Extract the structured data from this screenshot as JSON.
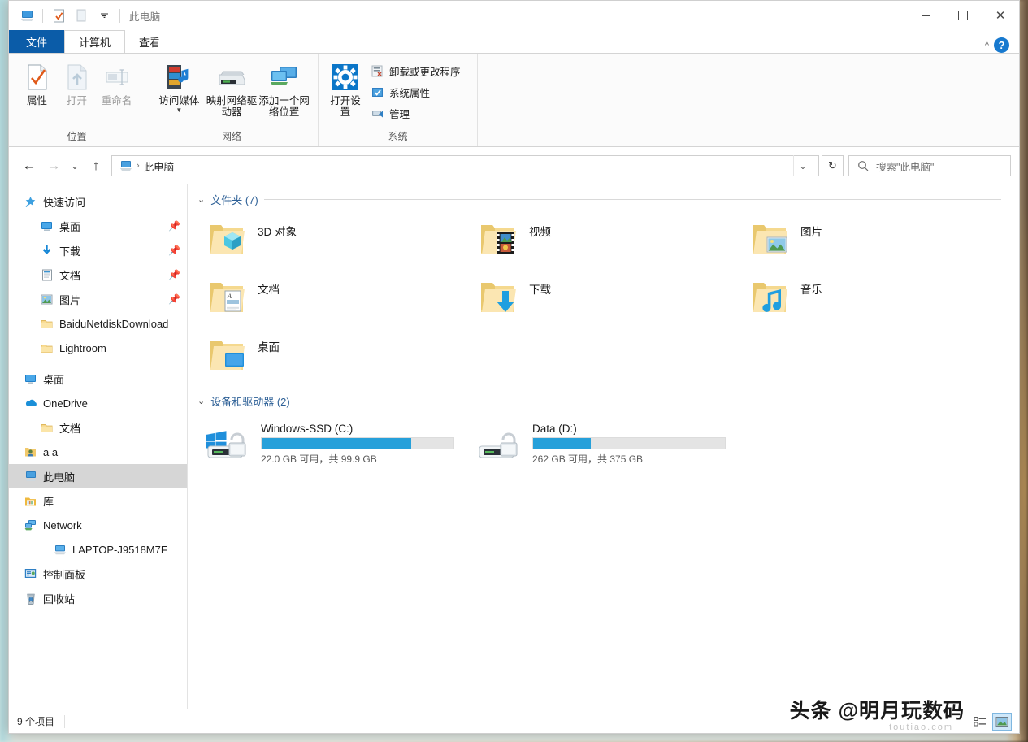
{
  "window": {
    "title": "此电脑",
    "quick_access_icons": [
      "this-pc-icon",
      "properties-check-icon",
      "open-folder-icon",
      "customize-dropdown-icon"
    ],
    "controls": {
      "minimize": "最小化",
      "maximize": "最大化",
      "close": "关闭"
    }
  },
  "tabs": [
    {
      "label": "文件",
      "type": "file"
    },
    {
      "label": "计算机",
      "type": "active"
    },
    {
      "label": "查看",
      "type": "normal"
    }
  ],
  "ribbon": {
    "collapse_label": "折叠功能区",
    "help_label": "?",
    "groups": [
      {
        "title": "位置",
        "big_buttons": [
          {
            "label": "属性",
            "icon": "properties-icon",
            "disabled": false
          },
          {
            "label": "打开",
            "icon": "open-icon",
            "disabled": true
          },
          {
            "label": "重命名",
            "icon": "rename-icon",
            "disabled": true
          }
        ],
        "small_items": []
      },
      {
        "title": "网络",
        "big_buttons": [
          {
            "label": "访问媒体",
            "icon": "access-media-icon",
            "disabled": false,
            "caret": true
          },
          {
            "label": "映射网络驱动器",
            "icon": "map-network-drive-icon",
            "disabled": false,
            "caret": true
          },
          {
            "label": "添加一个网络位置",
            "icon": "add-network-location-icon",
            "disabled": false,
            "caret": false
          }
        ],
        "small_items": []
      },
      {
        "title": "系统",
        "big_buttons": [
          {
            "label": "打开设置",
            "icon": "settings-gear-icon",
            "disabled": false
          }
        ],
        "small_items": [
          {
            "label": "卸载或更改程序",
            "icon": "uninstall-program-icon"
          },
          {
            "label": "系统属性",
            "icon": "system-properties-icon"
          },
          {
            "label": "管理",
            "icon": "manage-icon"
          }
        ]
      }
    ]
  },
  "addressbar": {
    "back": "后退",
    "forward": "前进",
    "recent": "最近位置",
    "up": "上移到",
    "path_icon": "this-pc-icon",
    "path_segments": [
      "此电脑"
    ],
    "dropdown": "历史记录",
    "refresh": "刷新",
    "search_placeholder": "搜索\"此电脑\""
  },
  "navpane": {
    "items": [
      {
        "label": "快速访问",
        "icon": "star-pin-icon",
        "level": 0,
        "pinned": false
      },
      {
        "label": "桌面",
        "icon": "desktop-icon",
        "level": 1,
        "pinned": true
      },
      {
        "label": "下载",
        "icon": "downloads-icon",
        "level": 1,
        "pinned": true
      },
      {
        "label": "文档",
        "icon": "documents-icon",
        "level": 1,
        "pinned": true
      },
      {
        "label": "图片",
        "icon": "pictures-icon",
        "level": 1,
        "pinned": true
      },
      {
        "label": "BaiduNetdiskDownload",
        "icon": "folder-icon",
        "level": 1,
        "pinned": false
      },
      {
        "label": "Lightroom",
        "icon": "folder-icon",
        "level": 1,
        "pinned": false
      },
      {
        "label": "",
        "icon": "gap",
        "level": 0,
        "pinned": false
      },
      {
        "label": "桌面",
        "icon": "desktop-icon",
        "level": 0,
        "pinned": false
      },
      {
        "label": "OneDrive",
        "icon": "onedrive-icon",
        "level": 0,
        "pinned": false
      },
      {
        "label": "文档",
        "icon": "folder-icon",
        "level": 1,
        "pinned": false
      },
      {
        "label": "a a",
        "icon": "user-icon",
        "level": 0,
        "pinned": false
      },
      {
        "label": "此电脑",
        "icon": "this-pc-icon",
        "level": 0,
        "pinned": false,
        "selected": true
      },
      {
        "label": "库",
        "icon": "library-icon",
        "level": 0,
        "pinned": false
      },
      {
        "label": "Network",
        "icon": "network-icon",
        "level": 0,
        "pinned": false
      },
      {
        "label": "LAPTOP-J9518M7F",
        "icon": "computer-icon",
        "level": 1,
        "pinned": false
      },
      {
        "label": "控制面板",
        "icon": "control-panel-icon",
        "level": 0,
        "pinned": false
      },
      {
        "label": "回收站",
        "icon": "recycle-bin-icon",
        "level": 0,
        "pinned": false
      }
    ]
  },
  "main": {
    "groups": [
      {
        "title": "文件夹 (7)",
        "kind": "folders",
        "items": [
          {
            "name": "3D 对象",
            "icon": "folder-3d-objects-icon"
          },
          {
            "name": "视频",
            "icon": "folder-videos-icon"
          },
          {
            "name": "图片",
            "icon": "folder-pictures-icon"
          },
          {
            "name": "文档",
            "icon": "folder-documents-icon"
          },
          {
            "name": "下载",
            "icon": "folder-downloads-icon"
          },
          {
            "name": "音乐",
            "icon": "folder-music-icon"
          },
          {
            "name": "桌面",
            "icon": "folder-desktop-icon"
          }
        ]
      },
      {
        "title": "设备和驱动器 (2)",
        "kind": "drives",
        "items": [
          {
            "name": "Windows-SSD (C:)",
            "icon": "windows-drive-icon",
            "free_text": "22.0 GB 可用，共 99.9 GB",
            "free_gb": 22.0,
            "total_gb": 99.9,
            "used_percent": 78
          },
          {
            "name": "Data (D:)",
            "icon": "hard-drive-icon",
            "free_text": "262 GB 可用，共 375 GB",
            "free_gb": 262,
            "total_gb": 375,
            "used_percent": 30
          }
        ]
      }
    ]
  },
  "statusbar": {
    "item_count": "9 个项目",
    "view_icons": [
      "details-view-icon",
      "large-icons-view-icon"
    ]
  },
  "watermark": {
    "text": "头条 @明月玩数码",
    "sub": "toutiao.com"
  },
  "colors": {
    "accent_blue": "#0b5ca8",
    "capacity_blue": "#26a0da",
    "group_title_blue": "#2c5f96",
    "selection_gray": "#d6d6d6"
  }
}
